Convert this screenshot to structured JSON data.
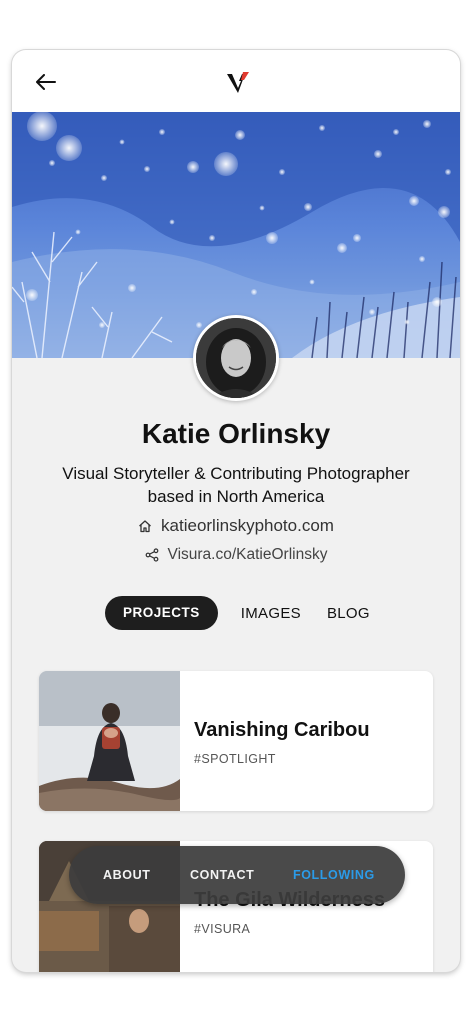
{
  "header": {
    "back_icon": "arrow-left-icon",
    "logo": "visura-logo",
    "logo_accent": "#e03a2f"
  },
  "profile": {
    "name": "Katie Orlinsky",
    "bio_line1": "Visual Storyteller & Contributing Photographer",
    "bio_line2": "based in North America",
    "website": "katieorlinskyphoto.com",
    "website_icon": "home-icon",
    "profile_link": "Visura.co/KatieOrlinsky",
    "profile_link_icon": "share-icon"
  },
  "tabs": [
    {
      "label": "PROJECTS",
      "active": true
    },
    {
      "label": "IMAGES",
      "active": false
    },
    {
      "label": "BLOG",
      "active": false
    }
  ],
  "projects": [
    {
      "title": "Vanishing Caribou",
      "tag": "#SPOTLIGHT"
    },
    {
      "title": "The Gila Wilderness",
      "tag": "#VISURA"
    }
  ],
  "bottom_nav": [
    {
      "label": "ABOUT",
      "active": false
    },
    {
      "label": "CONTACT",
      "active": false
    },
    {
      "label": "FOLLOWING",
      "active": true
    }
  ],
  "colors": {
    "accent": "#2b9be8",
    "active_tab_bg": "#1e1e1e",
    "page_bg": "#f1f1f1"
  }
}
